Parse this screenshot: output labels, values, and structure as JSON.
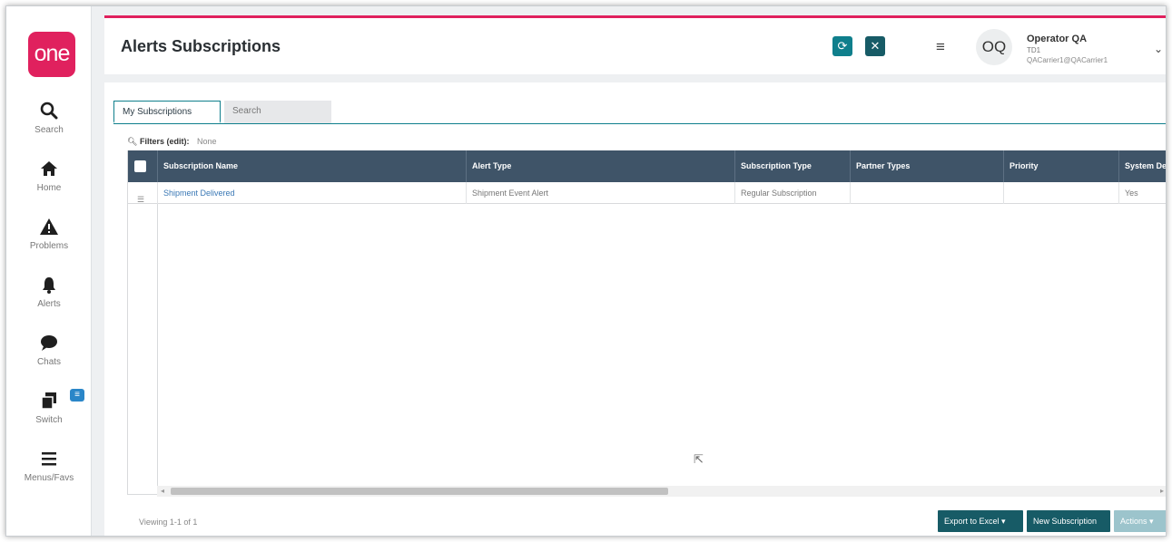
{
  "sidebar": {
    "logo_text": "one",
    "items": [
      {
        "label": "Search",
        "icon": "search-icon"
      },
      {
        "label": "Home",
        "icon": "home-icon"
      },
      {
        "label": "Problems",
        "icon": "warning-icon"
      },
      {
        "label": "Alerts",
        "icon": "bell-icon"
      },
      {
        "label": "Chats",
        "icon": "chat-icon"
      },
      {
        "label": "Switch",
        "icon": "switch-icon"
      },
      {
        "label": "Menus/Favs",
        "icon": "menu-icon"
      }
    ]
  },
  "header": {
    "title": "Alerts Subscriptions",
    "refresh_icon": "refresh-icon",
    "close_icon": "close-icon"
  },
  "user": {
    "initials": "OQ",
    "name": "Operator QA",
    "org": "TD1",
    "email": "QACarrier1@QACarrier1"
  },
  "tabs": [
    {
      "label": "My Subscriptions",
      "active": true
    },
    {
      "label": "Search",
      "active": false
    }
  ],
  "filters": {
    "label": "Filters (edit):",
    "value": "None"
  },
  "table": {
    "columns": [
      "Subscription Name",
      "Alert Type",
      "Subscription Type",
      "Partner Types",
      "Priority",
      "System Def"
    ],
    "rows": [
      {
        "subscription_name": "Shipment Delivered",
        "alert_type": "Shipment Event Alert",
        "subscription_type": "Regular Subscription",
        "partner_types": "",
        "priority": "",
        "system_def": "Yes"
      }
    ]
  },
  "footer": {
    "viewing": "Viewing 1-1 of 1",
    "export_label": "Export to Excel",
    "new_subscription_label": "New Subscription",
    "actions_label": "Actions"
  },
  "colors": {
    "brand": "#e0215e",
    "teal": "#0f7f8c",
    "header_row": "#3f5468"
  }
}
